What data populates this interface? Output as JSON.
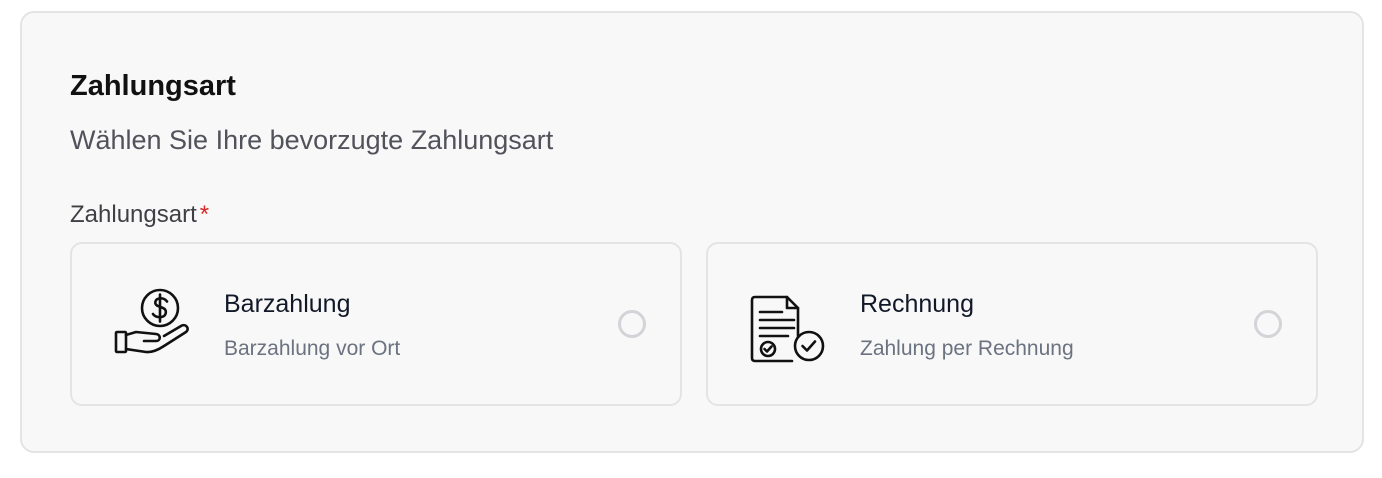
{
  "section": {
    "title": "Zahlungsart",
    "subtitle": "Wählen Sie Ihre bevorzugte Zahlungsart"
  },
  "field": {
    "label": "Zahlungsart",
    "required_mark": "*"
  },
  "options": [
    {
      "icon": "cash-payment-icon",
      "title": "Barzahlung",
      "description": "Barzahlung vor Ort",
      "selected": false
    },
    {
      "icon": "invoice-icon",
      "title": "Rechnung",
      "description": "Zahlung per Rechnung",
      "selected": false
    }
  ],
  "colors": {
    "required": "#dc2626",
    "radio_border": "#d4d4d8",
    "card_background": "#f8f8f8"
  }
}
